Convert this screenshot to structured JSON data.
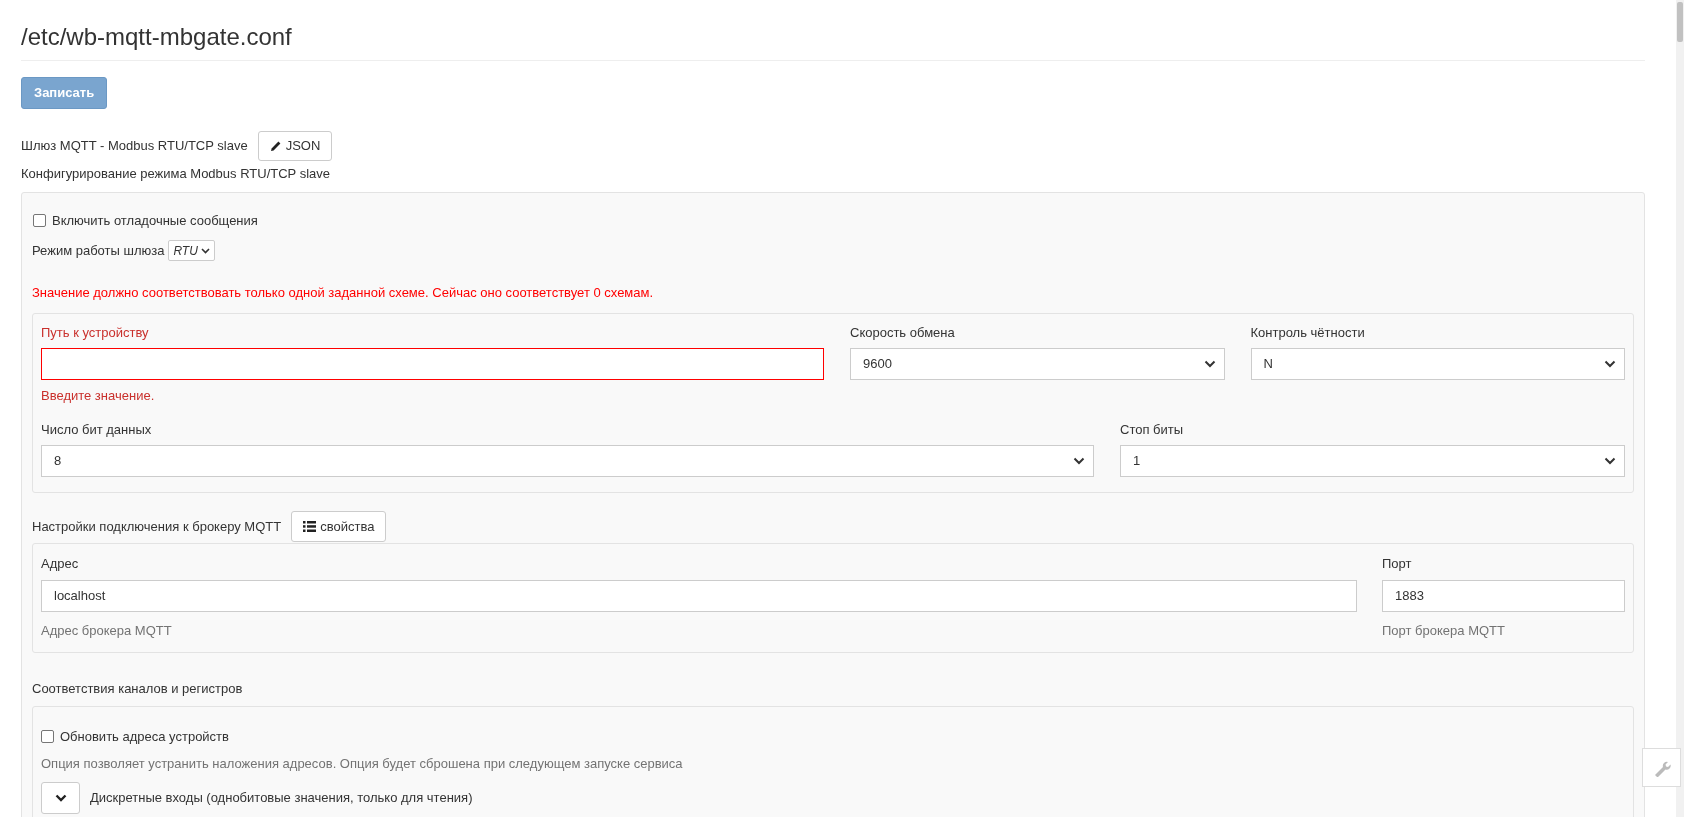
{
  "title": "/etc/wb-mqtt-mbgate.conf",
  "save_button": {
    "label": "Записать",
    "disabled": true
  },
  "schema": {
    "title": "Шлюз MQTT - Modbus RTU/TCP slave",
    "json_button": "JSON",
    "description": "Конфигурирование режима Modbus RTU/TCP slave"
  },
  "debug": {
    "label": "Включить отладочные сообщения",
    "checked": false
  },
  "mode": {
    "label": "Режим работы шлюза",
    "value": "RTU"
  },
  "error": "Значение должно соответствовать только одной заданной схеме. Сейчас оно соответствует 0 схемам.",
  "serial": {
    "path": {
      "label": "Путь к устройству",
      "invalid": true,
      "error": "Введите значение."
    },
    "row1": [
      {
        "label": "Скорость обмена",
        "value": "9600"
      },
      {
        "label": "Контроль чётности",
        "value": "N"
      }
    ],
    "row2": [
      {
        "label": "Число бит данных",
        "value": "8"
      },
      {
        "label": "Стоп биты",
        "value": "1"
      }
    ]
  },
  "mqtt": {
    "title": "Настройки подключения к брокеру MQTT",
    "properties_button": "свойства",
    "fields": [
      {
        "label": "Адрес",
        "value": "localhost",
        "help": "Адрес брокера MQTT"
      },
      {
        "label": "Порт",
        "value": "1883",
        "help": "Порт брокера MQTT"
      }
    ]
  },
  "registers": {
    "title": "Соответствия каналов и регистров",
    "update": {
      "label": "Обновить адреса устройств",
      "checked": false,
      "help": "Опция позволяет устранить наложения адресов. Опция будет сброшена при следующем запуске сервиса"
    },
    "section": {
      "label": "Дискретные входы (однобитовые значения, только для чтения)",
      "expanded": false
    }
  }
}
